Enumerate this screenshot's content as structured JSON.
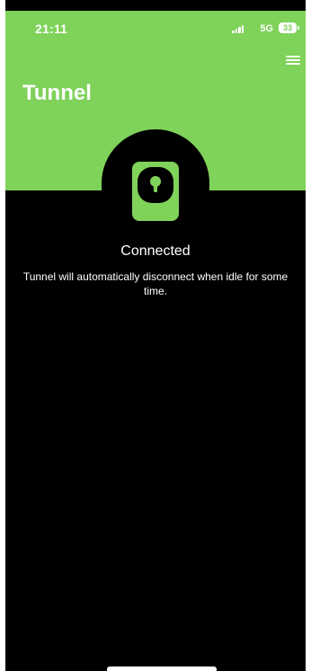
{
  "status_bar": {
    "time": "21:11",
    "network": "5G",
    "battery": "33",
    "icons": [
      "signal-icon",
      "battery-icon"
    ]
  },
  "header": {
    "title": "Tunnel",
    "menu_icon": "menu-icon"
  },
  "main": {
    "status_icon": "lock-icon",
    "status": "Connected",
    "message": "Tunnel will automatically disconnect when idle for some time."
  },
  "colors": {
    "accent": "#7fd25a",
    "background": "#000000",
    "text": "#ffffff"
  }
}
